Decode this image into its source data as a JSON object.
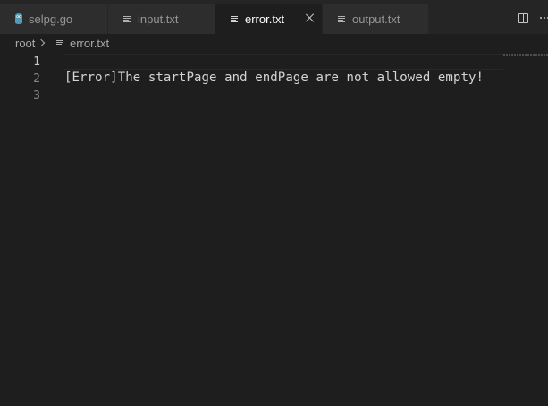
{
  "tabs": [
    {
      "label": "selpg.go",
      "icon": "gopher-icon",
      "active": false
    },
    {
      "label": "input.txt",
      "icon": "text-file-icon",
      "active": false
    },
    {
      "label": "error.txt",
      "icon": "text-file-icon",
      "active": true
    },
    {
      "label": "output.txt",
      "icon": "text-file-icon",
      "active": false
    }
  ],
  "breadcrumb": {
    "root": "root",
    "file": "error.txt"
  },
  "editor": {
    "line_numbers": [
      "1",
      "2",
      "3"
    ],
    "current_line": 1,
    "lines": [
      "",
      "[Error]The startPage and endPage are not allowed empty!",
      ""
    ]
  },
  "colors": {
    "tab_bar_bg": "#252526",
    "inactive_tab_bg": "#2d2d2d",
    "editor_bg": "#1e1e1e",
    "gopher_blue": "#519aba"
  }
}
